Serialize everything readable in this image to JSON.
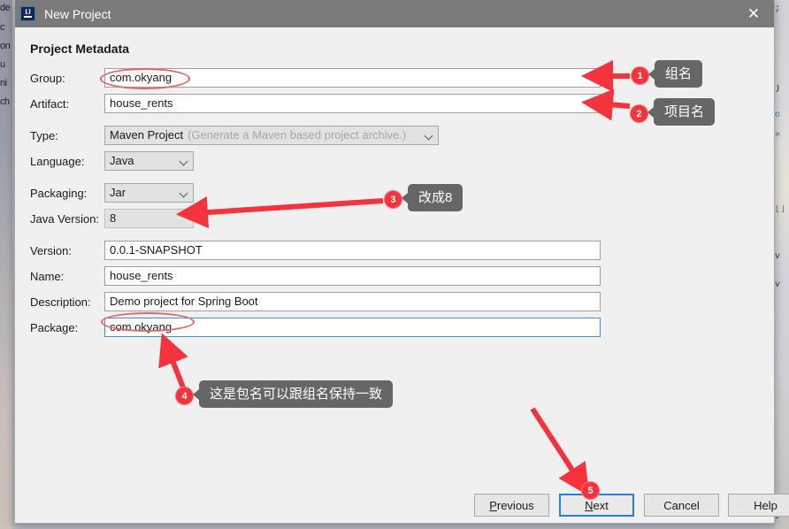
{
  "window": {
    "title": "New Project",
    "app_icon": "intellij-idea-icon",
    "close_icon": "close-icon"
  },
  "section": {
    "title": "Project Metadata"
  },
  "fields": [
    {
      "key": "group",
      "label": "Group:",
      "value": "com.okyang",
      "control": "text",
      "focused": false
    },
    {
      "key": "artifact",
      "label": "Artifact:",
      "value": "house_rents",
      "control": "text",
      "focused": false
    },
    {
      "key": "type",
      "label": "Type:",
      "value": "Maven Project",
      "hint": "(Generate a Maven based project archive.)",
      "control": "combo",
      "focused": false
    },
    {
      "key": "language",
      "label": "Language:",
      "value": "Java",
      "control": "combo",
      "focused": false
    },
    {
      "key": "packaging",
      "label": "Packaging:",
      "value": "Jar",
      "control": "combo",
      "focused": false
    },
    {
      "key": "javaversion",
      "label": "Java Version:",
      "value": "8",
      "control": "readonly",
      "focused": false
    },
    {
      "key": "version",
      "label": "Version:",
      "value": "0.0.1-SNAPSHOT",
      "control": "text",
      "focused": false
    },
    {
      "key": "name",
      "label": "Name:",
      "value": "house_rents",
      "control": "text",
      "focused": false
    },
    {
      "key": "description",
      "label": "Description:",
      "value": "Demo project for Spring Boot",
      "control": "text",
      "focused": false
    },
    {
      "key": "package",
      "label": "Package:",
      "value": "com.okyang",
      "control": "text",
      "focused": true
    }
  ],
  "buttons": {
    "previous": {
      "label": "Previous",
      "mnemonic": "P",
      "default": false
    },
    "next": {
      "label": "Next",
      "mnemonic": "N",
      "default": true
    },
    "cancel": {
      "label": "Cancel",
      "mnemonic": "",
      "default": false
    },
    "help": {
      "label": "Help",
      "mnemonic": "",
      "default": false
    }
  },
  "annotations": {
    "accent_color": "#f4333d",
    "tooltip_bg": "#666666",
    "items": [
      {
        "number": "1",
        "text": "组名",
        "target": "group-input"
      },
      {
        "number": "2",
        "text": "项目名",
        "target": "artifact-input"
      },
      {
        "number": "3",
        "text": "改成8",
        "target": "javaversion-value"
      },
      {
        "number": "4",
        "text": "这是包名可以跟组名保持一致",
        "target": "package-input"
      },
      {
        "number": "5",
        "text": "",
        "target": "next-button"
      }
    ]
  },
  "background": {
    "left_fragments": [
      "de",
      "c",
      "on",
      "u",
      "ni",
      "ch"
    ],
    "right_fragments": [
      ";",
      ")",
      "o",
      "»",
      "[]",
      "v",
      "v",
      "}"
    ]
  }
}
